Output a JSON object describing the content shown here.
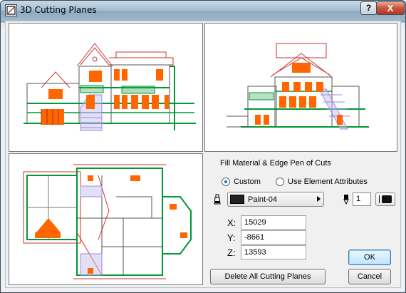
{
  "window": {
    "title": "3D Cutting Planes",
    "help_label": "?",
    "close_label": "X"
  },
  "views": {
    "front": "front-elevation-view",
    "side": "side-elevation-view",
    "plan": "plan-view"
  },
  "fill": {
    "group_label": "Fill Material & Edge Pen of Cuts",
    "options": [
      "Custom",
      "Use Element Attributes"
    ],
    "selected": "Custom",
    "material": "Paint-04",
    "material_color": "#222222",
    "pen_number": "1",
    "pen_color": "#111111"
  },
  "coords": {
    "x_label": "X:",
    "x": "15029",
    "y_label": "Y:",
    "y": "-8661",
    "z_label": "Z:",
    "z": "13593"
  },
  "buttons": {
    "ok": "OK",
    "cancel": "Cancel",
    "delete_all": "Delete All Cutting Planes"
  },
  "colors": {
    "accent_orange": "#ff6600",
    "green": "#009933",
    "red_line": "#cc3333",
    "purple": "#9a8ce0"
  }
}
